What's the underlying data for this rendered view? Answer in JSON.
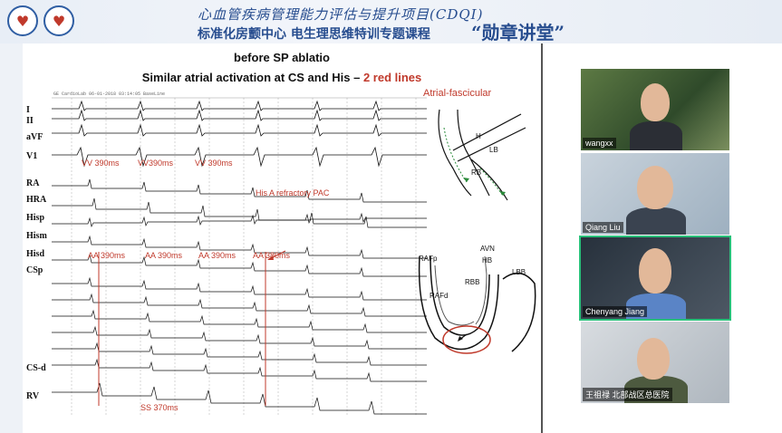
{
  "header": {
    "project_title": "心血管疾病管理能力评估与提升项目(CDQI)",
    "course_title": "标准化房颤中心 电生理思维特训专题课程",
    "brand": "“勋章讲堂”",
    "logo_left_icon": "heart-logo-icon",
    "logo_right_icon": "heart-logo-icon"
  },
  "slide": {
    "title_line1": "before SP ablatio",
    "title_line2_prefix": "Similar atrial activation at CS and His – ",
    "title_line2_highlight": "2 red lines",
    "ecg_header": "GE CardioLab   06-01-2018  03:14:05  BaseLine",
    "lead_labels": [
      "I",
      "II",
      "aVF",
      "V1",
      "RA",
      "HRA",
      "Hisp",
      "Hism",
      "Hisd",
      "CSp",
      "CS-d",
      "RV"
    ],
    "vv_labels": [
      "VV 390ms",
      "VV390ms",
      "VV 390ms"
    ],
    "aa_labels": [
      "AA 390ms",
      "AA 390ms",
      "AA 390ms",
      "AA 380ms"
    ],
    "pac_label": "His A refractory PAC",
    "ss_label": "SS 370ms",
    "diagram1_title": "Atrial-fascicular",
    "diagram1_labels": [
      "H",
      "LB",
      "RB"
    ],
    "diagram2_labels": [
      "AVN",
      "RAFp",
      "HB",
      "LBB",
      "RBB",
      "RAFd"
    ]
  },
  "participants": [
    {
      "name": "wangxx",
      "active": false
    },
    {
      "name": "Qiang Liu",
      "active": false
    },
    {
      "name": "Chenyang Jiang",
      "active": true
    },
    {
      "name": "王祖禄 北部战区总医院",
      "active": false
    }
  ],
  "colors": {
    "brand_blue": "#274d8f",
    "accent_red": "#c0392b",
    "active_speaker": "#29c07a"
  }
}
